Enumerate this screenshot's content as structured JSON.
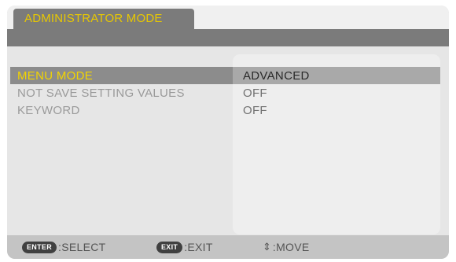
{
  "tab": {
    "label": "ADMINISTRATOR MODE"
  },
  "rows": [
    {
      "label": "MENU MODE",
      "value": "ADVANCED"
    },
    {
      "label": "NOT SAVE SETTING VALUES",
      "value": "OFF"
    },
    {
      "label": "KEYWORD",
      "value": "OFF"
    }
  ],
  "footer": {
    "enter_key": "ENTER",
    "enter_text": ":SELECT",
    "exit_key": "EXIT",
    "exit_text": ":EXIT",
    "move_symbol": "⇕",
    "move_text": ":MOVE"
  },
  "colors": {
    "selected_text": "#f2d400",
    "tab_text": "#e8c800",
    "title_bar": "#7b7b7b"
  }
}
